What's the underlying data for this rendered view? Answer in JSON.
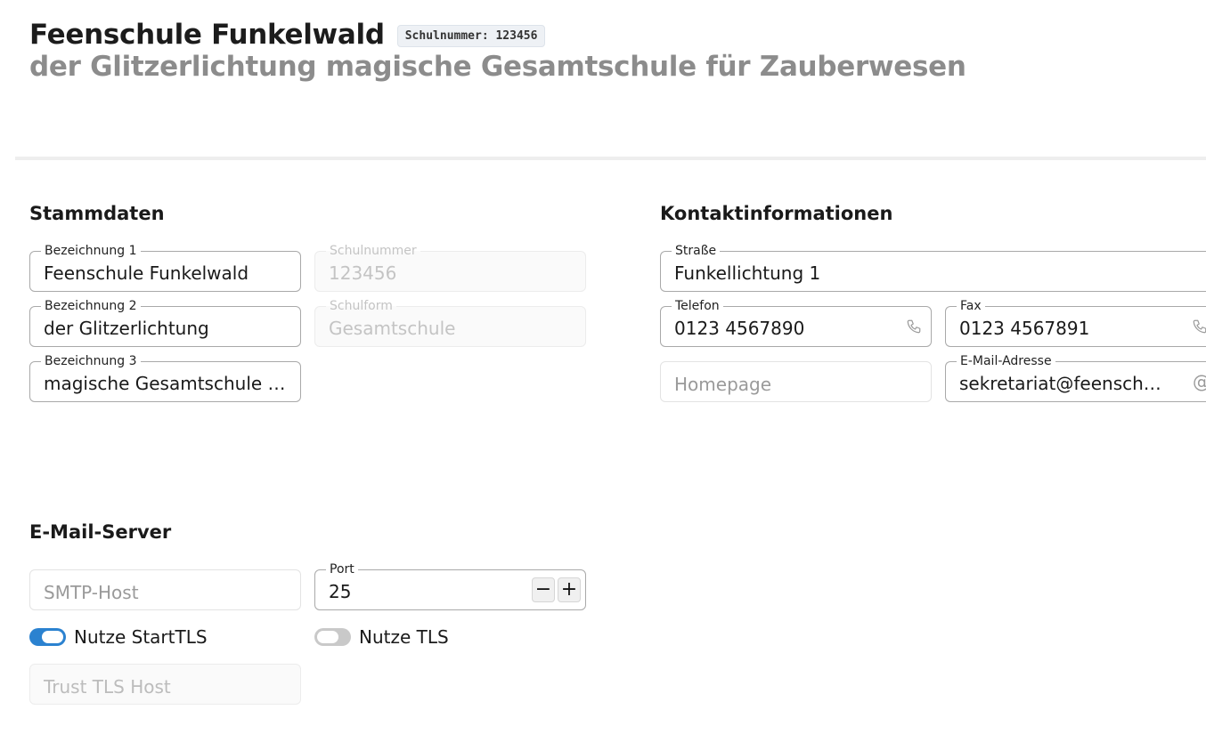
{
  "header": {
    "title": "Feenschule Funkelwald",
    "badge": "Schulnummer: 123456",
    "subtitle": "der Glitzerlichtung magische Gesamtschule für Zauberwesen"
  },
  "stammdaten": {
    "title": "Stammdaten",
    "bezeichnung1": {
      "label": "Bezeichnung 1",
      "value": "Feenschule Funkelwald"
    },
    "bezeichnung2": {
      "label": "Bezeichnung 2",
      "value": "der Glitzerlichtung"
    },
    "bezeichnung3": {
      "label": "Bezeichnung 3",
      "value": "magische Gesamtschule für Zauberwesen"
    },
    "schulnummer": {
      "label": "Schulnummer",
      "value": "123456"
    },
    "schulform": {
      "label": "Schulform",
      "value": "Gesamtschule"
    }
  },
  "kontakt": {
    "title": "Kontaktinformationen",
    "strasse": {
      "label": "Straße",
      "value": "Funkellichtung 1"
    },
    "telefon": {
      "label": "Telefon",
      "value": "0123 4567890",
      "icon": "phone-icon"
    },
    "fax": {
      "label": "Fax",
      "value": "0123 4567891",
      "icon": "phone-icon"
    },
    "homepage": {
      "placeholder": "Homepage"
    },
    "email": {
      "label": "E-Mail-Adresse",
      "value": "sekretariat@feenschule-funkelwald.de",
      "icon": "at-icon"
    }
  },
  "mailserver": {
    "title": "E-Mail-Server",
    "smtp_host": {
      "placeholder": "SMTP-Host"
    },
    "port": {
      "label": "Port",
      "value": "25",
      "minus": "−",
      "plus": "+"
    },
    "starttls": {
      "label": "Nutze StartTLS",
      "checked": true
    },
    "tls": {
      "label": "Nutze TLS",
      "checked": false
    },
    "trust_host": {
      "placeholder": "Trust TLS Host"
    }
  },
  "colors": {
    "accent": "#2b82d0",
    "toggle_off": "#c9c9c9"
  }
}
